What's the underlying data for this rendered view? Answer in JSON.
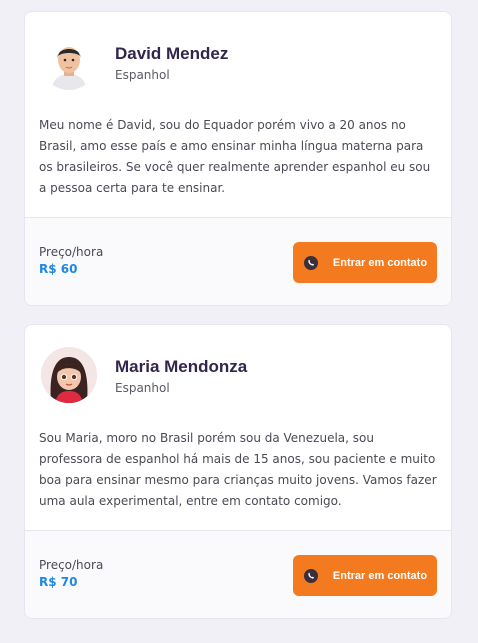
{
  "teachers": [
    {
      "name": "David Mendez",
      "subject": "Espanhol",
      "bio": "Meu nome é David, sou do Equador porém vivo a 20 anos no Brasil, amo esse país e amo ensinar minha língua materna para os brasileiros. Se você quer realmente aprender espanhol eu sou a pessoa certa para te ensinar.",
      "price_label": "Preço/hora",
      "price": "R$ 60",
      "contact_label": "Entrar em contato"
    },
    {
      "name": "Maria Mendonza",
      "subject": "Espanhol",
      "bio": "Sou Maria, moro no Brasil porém sou da Venezuela, sou professora de espanhol há mais de 15 anos, sou paciente e muito boa para ensinar mesmo para crianças muito jovens. Vamos fazer uma aula experimental, entre em contato comigo.",
      "price_label": "Preço/hora",
      "price": "R$ 70",
      "contact_label": "Entrar em contato"
    }
  ],
  "colors": {
    "accent": "#f47a20",
    "price": "#1e88e5",
    "name": "#32264d",
    "background": "#f0f0f6"
  },
  "icons": {
    "contact": "whatsapp-icon",
    "avatar": "avatar"
  }
}
